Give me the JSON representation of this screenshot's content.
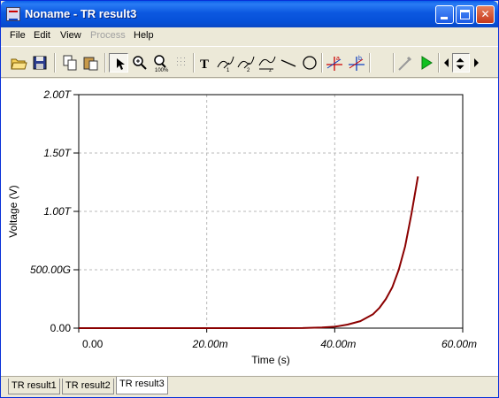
{
  "window": {
    "title": "Noname - TR result3",
    "controls": {
      "minimize": "minimize-icon",
      "maximize": "maximize-icon",
      "close": "close-icon"
    }
  },
  "menu": {
    "items": [
      {
        "label": "File",
        "enabled": true
      },
      {
        "label": "Edit",
        "enabled": true
      },
      {
        "label": "View",
        "enabled": true
      },
      {
        "label": "Process",
        "enabled": false
      },
      {
        "label": "Help",
        "enabled": true
      }
    ]
  },
  "toolbar": {
    "tools": [
      "open-folder-icon",
      "save-icon",
      "copy-icon",
      "paste-icon",
      "select-arrow-icon",
      "zoom-in-icon",
      "zoom-fit-icon",
      "grid-icon",
      "text-tool-icon",
      "waveform-label-1-icon",
      "waveform-label-2-icon",
      "waveform-label-3-icon",
      "line-tool-icon",
      "circle-tool-icon",
      "cursor-a-icon",
      "cursor-b-icon",
      "blank-tool",
      "probe-icon",
      "run-icon",
      "scroll-left-icon",
      "scroll-updown-icon",
      "scroll-right-icon"
    ]
  },
  "chart_data": {
    "type": "line",
    "title": "",
    "xlabel": "Time (s)",
    "ylabel": "Voltage (V)",
    "xlim": [
      0,
      0.06
    ],
    "ylim": [
      0,
      2000000000000.0
    ],
    "grid": true,
    "x_ticks": [
      "0.00",
      "20.00m",
      "40.00m",
      "60.00m"
    ],
    "y_ticks": [
      "0.00",
      "500.00G",
      "1.00T",
      "1.50T",
      "2.00T"
    ],
    "series": [
      {
        "color": "#8b0000",
        "x": [
          0.0,
          0.01,
          0.02,
          0.03,
          0.035,
          0.038,
          0.04,
          0.042,
          0.044,
          0.046,
          0.047,
          0.048,
          0.049,
          0.05,
          0.051,
          0.052,
          0.053
        ],
        "y": [
          0,
          0,
          0,
          0,
          1000000000.0,
          5000000000.0,
          12000000000.0,
          30000000000.0,
          60000000000.0,
          120000000000.0,
          175000000000.0,
          250000000000.0,
          350000000000.0,
          500000000000.0,
          700000000000.0,
          980000000000.0,
          1300000000000.0
        ]
      }
    ]
  },
  "tabs": [
    {
      "label": "TR result1",
      "active": false
    },
    {
      "label": "TR result2",
      "active": false
    },
    {
      "label": "TR result3",
      "active": true
    }
  ]
}
